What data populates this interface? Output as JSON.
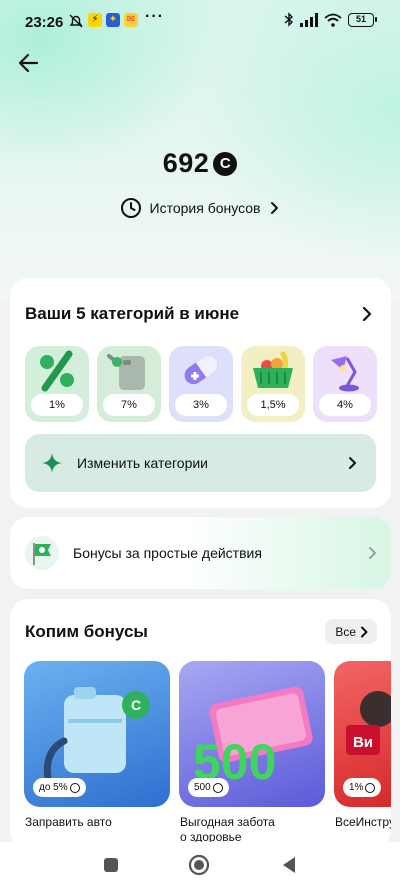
{
  "status_bar": {
    "time": "23:26",
    "overflow": "···",
    "battery": "51",
    "icons": [
      "alarm-off-icon",
      "app-notification-icon",
      "app-notification-icon",
      "mail-icon",
      "bluetooth-icon",
      "signal-icon",
      "wifi-icon",
      "battery-icon"
    ]
  },
  "header": {
    "back_icon": "arrow-left-icon"
  },
  "balance": {
    "value": "692",
    "currency_glyph": "С"
  },
  "history": {
    "label": "История бонусов",
    "icon": "clock-icon"
  },
  "categories": {
    "title": "Ваши 5 категорий в июне",
    "items": [
      {
        "name": "percent",
        "value": "1%",
        "bg": "#d3efdc"
      },
      {
        "name": "canister",
        "value": "7%",
        "bg": "#d5ecd9"
      },
      {
        "name": "pill",
        "value": "3%",
        "bg": "#dee0fb"
      },
      {
        "name": "basket",
        "value": "1,5%",
        "bg": "#f2efc5"
      },
      {
        "name": "lamp",
        "value": "4%",
        "bg": "#ece0fb"
      }
    ],
    "change_label": "Изменить категории",
    "change_icon": "sparkle-icon"
  },
  "simple_actions": {
    "label": "Бонусы за простые действия",
    "icon": "flag-icon"
  },
  "accumulate": {
    "title": "Копим бонусы",
    "all_label": "Все",
    "offers": [
      {
        "pill": "до 5%",
        "caption_lines": [
          "Заправить авто"
        ],
        "bg": "#3b7fd9"
      },
      {
        "pill": "500",
        "big": "500",
        "caption_lines": [
          "Выгодная забота",
          "о здоровье"
        ],
        "bg": "#6a69e0"
      },
      {
        "pill": "1%",
        "logo": "Ви",
        "caption_lines": [
          "ВсеИнструменты"
        ],
        "bg": "#e63a3a"
      }
    ]
  },
  "nav": {
    "icons": [
      "recent-apps-icon",
      "home-icon",
      "back-triangle-icon"
    ]
  },
  "colors": {
    "accent_green": "#1b9a55",
    "text": "#111111",
    "card": "#ffffff"
  }
}
